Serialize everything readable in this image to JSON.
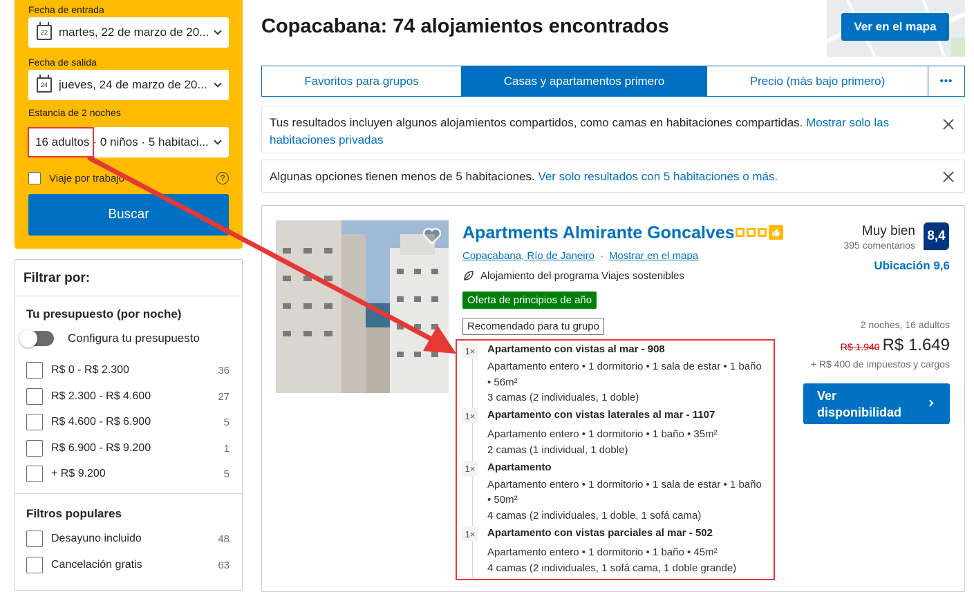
{
  "search": {
    "checkin_label": "Fecha de entrada",
    "checkin_value": "martes, 22 de marzo de 20...",
    "checkin_day": "22",
    "checkout_label": "Fecha de salida",
    "checkout_value": "jueves, 24 de marzo de 20...",
    "checkout_day": "24",
    "stay_label": "Estancia de 2 noches",
    "adults": "16 adultos",
    "rest": "· 0 niños · 5 habitaci...",
    "business_trip": "Viaje por trabajo",
    "help_icon": "?",
    "search_button": "Buscar"
  },
  "filter": {
    "title": "Filtrar por:",
    "budget_title": "Tu presupuesto (por noche)",
    "budget_toggle": "Configura tu presupuesto",
    "budget_options": [
      {
        "label": "R$ 0 - R$ 2.300",
        "count": "36"
      },
      {
        "label": "R$ 2.300 - R$ 4.600",
        "count": "27"
      },
      {
        "label": "R$ 4.600 - R$ 6.900",
        "count": "5"
      },
      {
        "label": "R$ 6.900 - R$ 9.200",
        "count": "1"
      },
      {
        "label": "+ R$ 9.200",
        "count": "5"
      }
    ],
    "popular_title": "Filtros populares",
    "popular_options": [
      {
        "label": "Desayuno incluido",
        "count": "48"
      },
      {
        "label": "Cancelación gratis",
        "count": "63"
      }
    ]
  },
  "main": {
    "title": "Copacabana: 74 alojamientos encontrados",
    "map_button": "Ver en el mapa",
    "tabs": [
      "Favoritos para grupos",
      "Casas y apartamentos primero",
      "Precio (más bajo primero)"
    ],
    "more_icon": "•••",
    "notice1_text": "Tus resultados incluyen algunos alojamientos compartidos, como camas en habitaciones compartidas. ",
    "notice1_link": "Mostrar solo las habitaciones privadas",
    "notice2_text": "Algunas opciones tienen menos de 5 habitaciones. ",
    "notice2_link": "Ver solo resultados con 5 habitaciones o más."
  },
  "property": {
    "name": "Apartments Almirante Goncalves",
    "location": "Copacabana, Río de Janeiro",
    "map_link": "Mostrar en el mapa",
    "separator": "·",
    "sustainable": "Alojamiento del programa Viajes sostenibles",
    "deal_badge": "Oferta de principios de año",
    "group_badge": "Recomendado para tu grupo",
    "rating_word": "Muy bien",
    "reviews": "395 comentarios",
    "score": "8,4",
    "location_score": "Ubicación 9,6",
    "stay_info": "2 noches, 16 adultos",
    "old_price": "R$ 1.940",
    "price": "R$ 1.649",
    "taxes": "+ R$ 400 de impuestos y cargos",
    "availability_button": "Ver disponibilidad",
    "rooms": [
      {
        "qty": "1×",
        "name": "Apartamento con vistas al mar - 908",
        "line1": "Apartamento entero • 1 dormitorio • 1 sala de estar • 1 baño",
        "line2": "• 56m²",
        "beds": "3 camas (2 individuales, 1 doble)"
      },
      {
        "qty": "1×",
        "name": "Apartamento con vistas laterales al mar - 1107",
        "line1": "Apartamento entero • 1 dormitorio • 1 baño • 35m²",
        "beds": "2 camas (1 individual, 1 doble)"
      },
      {
        "qty": "1×",
        "name": "Apartamento",
        "line1": "Apartamento entero • 1 dormitorio • 1 sala de estar • 1 baño",
        "line2": "• 50m²",
        "beds": "4 camas (2 individuales, 1 doble, 1 sofá cama)"
      },
      {
        "qty": "1×",
        "name": "Apartamento con vistas parciales al mar - 502",
        "line1": "Apartamento entero • 1 dormitorio • 1 baño • 45m²",
        "beds": "4 camas (2 individuales, 1 sofá cama, 1 doble grande)"
      }
    ]
  },
  "colors": {
    "brand_blue": "#0071c2",
    "search_yellow": "#febb02",
    "annotation_red": "#e53935",
    "deal_green": "#008009",
    "score_navy": "#003580"
  }
}
